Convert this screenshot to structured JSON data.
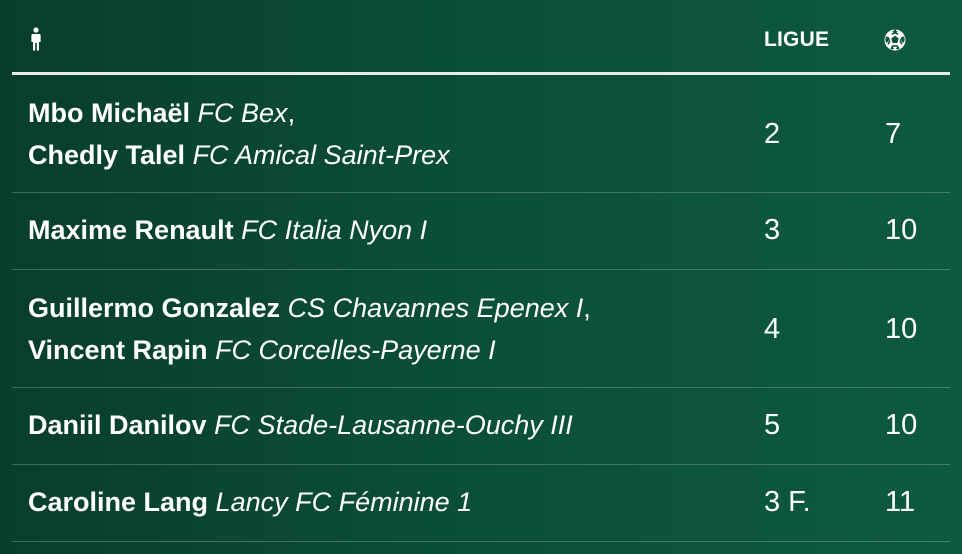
{
  "header": {
    "player_col_icon": "person-icon",
    "ligue_label": "LIGUE",
    "goals_col_icon": "soccer-ball-icon"
  },
  "rows": [
    {
      "players": [
        {
          "name": "Mbo Michaël",
          "club": "FC Bex",
          "sep": ","
        },
        {
          "name": "Chedly Talel",
          "club": "FC Amical Saint-Prex",
          "sep": ""
        }
      ],
      "ligue": "2",
      "goals": "7"
    },
    {
      "players": [
        {
          "name": "Maxime Renault",
          "club": "FC Italia Nyon I",
          "sep": ""
        }
      ],
      "ligue": "3",
      "goals": "10"
    },
    {
      "players": [
        {
          "name": "Guillermo Gonzalez",
          "club": "CS Chavannes Epenex I",
          "sep": ","
        },
        {
          "name": "Vincent Rapin",
          "club": "FC Corcelles-Payerne I",
          "sep": ""
        }
      ],
      "ligue": "4",
      "goals": "10"
    },
    {
      "players": [
        {
          "name": "Daniil Danilov",
          "club": "FC Stade-Lausanne-Ouchy III",
          "sep": ""
        }
      ],
      "ligue": "5",
      "goals": "10"
    },
    {
      "players": [
        {
          "name": "Caroline Lang",
          "club": "Lancy FC Féminine 1",
          "sep": ""
        }
      ],
      "ligue": "3 F.",
      "goals": "11"
    }
  ],
  "colors": {
    "background_start": "#083d2c",
    "background_end": "#0d5a3f",
    "text": "#ffffff",
    "header_rule": "#e6ece9"
  }
}
